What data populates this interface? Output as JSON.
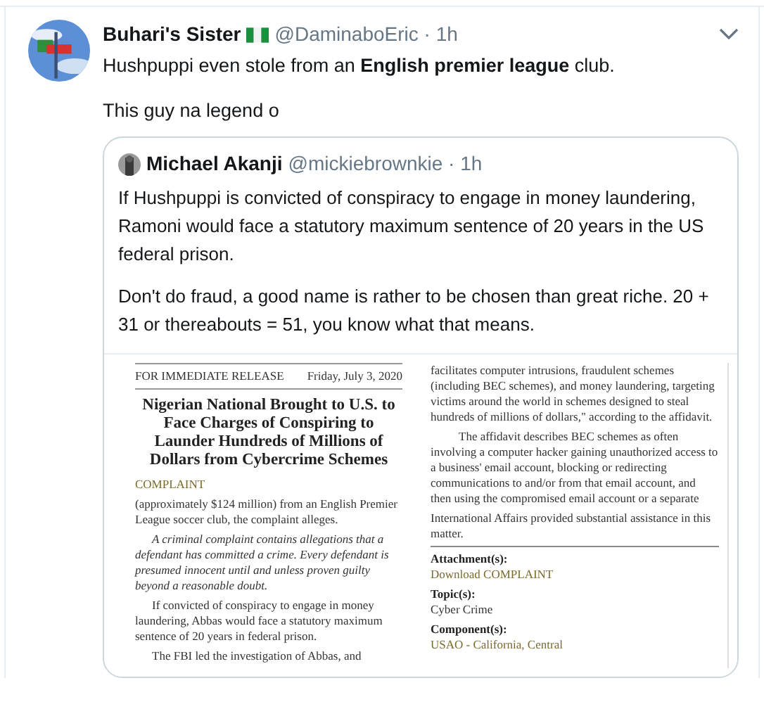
{
  "tweet": {
    "author": "Buhari's Sister",
    "meta": "@DaminaboEric · 1h",
    "paragraphs": [
      "Hushpuppi even stole from an **English premier league** club.",
      "This guy na legend o"
    ],
    "quoted": {
      "author": "Michael Akanji",
      "meta": "@mickiebrownkie · 1h",
      "paragraphs": [
        "If Hushpuppi is convicted of conspiracy to engage in money laundering, Ramoni would face a statutory maximum sentence of 20 years in the US federal prison.",
        "Don't do fraud, a good name is rather to be chosen than great riche. 20 + 31 or thereabouts = 51, you know what that means."
      ],
      "document": {
        "release": "FOR IMMEDIATE RELEASE",
        "date": "Friday, July 3, 2020",
        "headline": "Nigerian National Brought to U.S. to Face Charges of Conspiring to Launder Hundreds of Millions of Dollars from Cybercrime Schemes",
        "section": "COMPLAINT",
        "left_paragraphs": [
          {
            "text": "(approximately $124 million) from an English Premier League soccer club, the complaint alleges.",
            "italic": false,
            "indent": false
          },
          {
            "text": "A criminal complaint contains allegations that a defendant has committed a crime. Every defendant is presumed innocent until and unless proven guilty beyond a reasonable doubt.",
            "italic": true,
            "indent": true
          },
          {
            "text": "If convicted of conspiracy to engage in money laundering, Abbas would face a statutory maximum sentence of 20 years in federal prison.",
            "italic": false,
            "indent": true
          },
          {
            "text": "The FBI led the investigation of Abbas, and",
            "italic": false,
            "indent": true
          }
        ],
        "right_paragraphs": [
          {
            "text": "facilitates computer intrusions, fraudulent schemes (including BEC schemes), and money laundering, targeting victims around the world in schemes designed to steal hundreds of millions of dollars,\" according to the affidavit.",
            "indent": false
          },
          {
            "text": "The affidavit describes BEC schemes as often involving a computer hacker gaining unauthorized access to a business' email account, blocking or redirecting communications to and/or from that email account, and then using the compromised email account or a separate",
            "indent": true
          },
          {
            "text": "International Affairs provided substantial assistance in this matter.",
            "indent": false
          }
        ],
        "details": [
          {
            "label": "Attachment(s):",
            "value": "Download COMPLAINT",
            "kind": "link"
          },
          {
            "label": "Topic(s):",
            "value": "Cyber Crime",
            "kind": "plain"
          },
          {
            "label": "Component(s):",
            "value": "USAO - California, Central",
            "kind": "link"
          }
        ]
      }
    }
  }
}
